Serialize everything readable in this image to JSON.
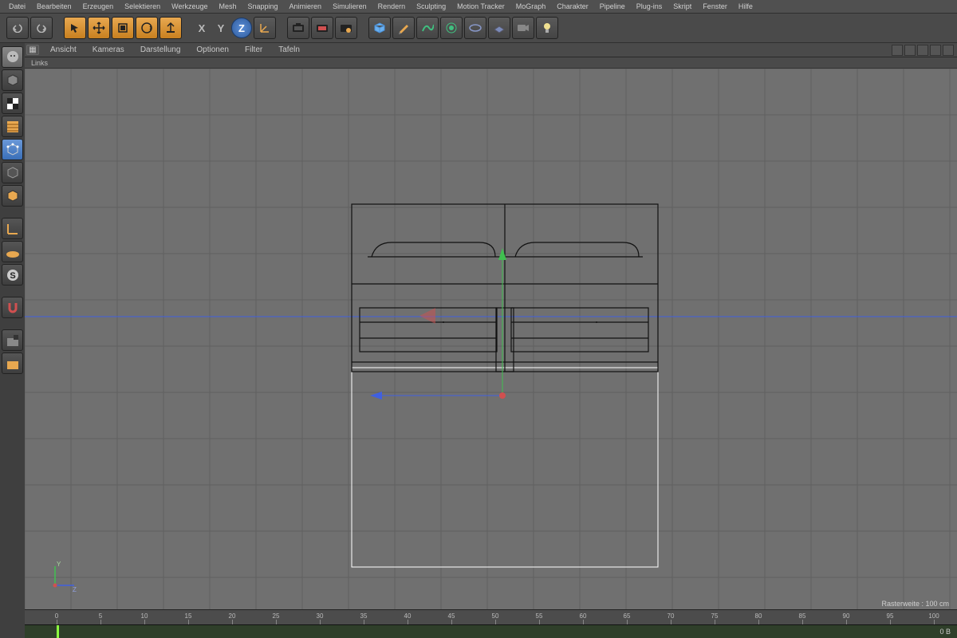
{
  "menubar": [
    "Datei",
    "Bearbeiten",
    "Erzeugen",
    "Selektieren",
    "Werkzeuge",
    "Mesh",
    "Snapping",
    "Animieren",
    "Simulieren",
    "Rendern",
    "Sculpting",
    "Motion Tracker",
    "MoGraph",
    "Charakter",
    "Pipeline",
    "Plug-ins",
    "Skript",
    "Fenster",
    "Hilfe"
  ],
  "axis_labels": {
    "x": "X",
    "y": "Y",
    "z": "Z"
  },
  "viewport_menu": [
    "Ansicht",
    "Kameras",
    "Darstellung",
    "Optionen",
    "Filter",
    "Tafeln"
  ],
  "viewport_label": "Links",
  "mini_axis": {
    "y": "Y",
    "z": "Z"
  },
  "status": "Rasterweite : 100 cm",
  "timeline": {
    "ticks_major": [
      0,
      5,
      10,
      15,
      20,
      25,
      30,
      35,
      40,
      45,
      50,
      55,
      60,
      65,
      70,
      75,
      80,
      85,
      90,
      95,
      100
    ],
    "frame_label": "0 B"
  },
  "toolbar_icons": [
    "undo",
    "redo",
    "",
    "select",
    "move",
    "scale",
    "rotate",
    "place",
    "",
    "axis-x",
    "axis-y",
    "axis-z",
    "coords",
    "",
    "render",
    "render-region",
    "render-settings",
    "",
    "primitive",
    "pen",
    "spline",
    "deformer",
    "environment",
    "camera",
    "light"
  ],
  "left_icons": [
    "model-mode",
    "texture-mode",
    "uv-mode",
    "point-mode",
    "edge-mode",
    "polygon-mode",
    "",
    "axis-mode",
    "workplane",
    "snap",
    "",
    "magnet",
    "",
    "layer-lock",
    "layer"
  ],
  "colors": {
    "x_axis": "#d05050",
    "y_axis": "#40c050",
    "z_axis": "#4060e0",
    "sel": "#ffffff"
  }
}
